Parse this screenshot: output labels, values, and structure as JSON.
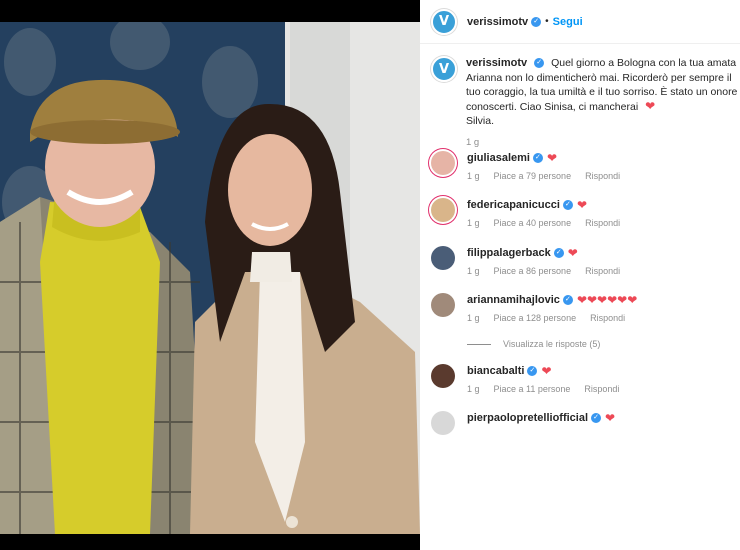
{
  "post": {
    "account": "verissimotv",
    "follow_label": "Segui",
    "separator": "•",
    "avatar_letter": "V",
    "caption_text": "Quel giorno a Bologna con la tua amata Arianna non lo dimenticherò mai. Ricorderò per sempre il tuo coraggio, la tua umiltà e il tuo sorriso. È stato un onore conoscerti. Ciao Sinisa, ci mancherai",
    "caption_heart": "❤",
    "caption_signature": "Silvia.",
    "time": "1 g"
  },
  "comments": [
    {
      "user": "giuliasalemi",
      "hearts": "❤",
      "meta": null
    },
    {
      "user": "federicapanicucci",
      "hearts": "❤",
      "time": "1 g",
      "likes": "Piace a 79 persone",
      "reply": "Rispondi"
    },
    {
      "user": "filippalagerback",
      "hearts": "❤",
      "time": "1 g",
      "likes": "Piace a 40 persone",
      "reply": "Rispondi"
    },
    {
      "user": "ariannamihajlovic",
      "hearts": "❤❤❤❤❤❤",
      "time": "1 g",
      "likes": "Piace a 86 persone",
      "reply": "Rispondi"
    },
    {
      "user": "biancabalti",
      "hearts": "❤",
      "time": "1 g",
      "likes": "Piace a 128 persone",
      "reply": "Rispondi"
    },
    {
      "user": "pierpaolopretelliofficial",
      "hearts": "❤",
      "time": "1 g",
      "likes": "Piace a 11 persone",
      "reply": "Rispondi"
    }
  ],
  "first_meta": {
    "time": "1 g",
    "likes": "Piace a 79 persone",
    "reply": "Rispondi"
  },
  "rows": [
    {
      "time": "1 g",
      "likes": "Piace a 79 persone",
      "reply": "Rispondi"
    },
    {
      "time": "1 g",
      "likes": "Piace a 40 persone",
      "reply": "Rispondi"
    },
    {
      "time": "1 g",
      "likes": "Piace a 86 persone",
      "reply": "Rispondi"
    },
    {
      "time": "1 g",
      "likes": "Piace a 128 persone",
      "reply": "Rispondi"
    },
    {
      "time": "1 g",
      "likes": "Piace a 11 persone",
      "reply": "Rispondi"
    }
  ],
  "view_replies": "Visualizza le risposte (5)",
  "colors": {
    "brand": "#3aa0d8",
    "link": "#0095f6",
    "heart": "#ed4956",
    "muted": "#8e8e8e",
    "verified": "#3897f0"
  },
  "icons": {
    "verified": "verified-badge-icon",
    "heart": "heart-icon"
  }
}
